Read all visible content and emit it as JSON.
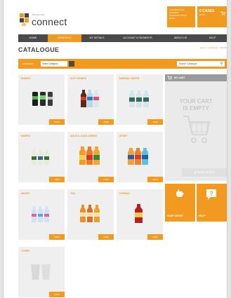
{
  "header": {
    "logo_small": "Woolworths",
    "logo_text": "connect",
    "account_lines": [
      "LOGGED IN AS",
      "MONGRD",
      "ACCOUNT STATE",
      "£8.00"
    ],
    "cart_count": "0 CASES",
    "cart_amount": "£0.00"
  },
  "nav": {
    "items": [
      {
        "label": "HOME",
        "active": false
      },
      {
        "label": "ORDERING",
        "active": true
      },
      {
        "label": "MY DETAILS",
        "active": false
      },
      {
        "label": "ACCOUNT & PAYMENTS",
        "active": false
      },
      {
        "label": "ABOUT US",
        "active": false
      },
      {
        "label": "HELP",
        "active": false
      }
    ]
  },
  "page": {
    "title": "CATALOGUE",
    "breadcrumb": {
      "home": "Home",
      "sep1": " > ",
      "catalogue": "Catalogue",
      "sep2": " > ",
      "current": "Search"
    }
  },
  "filter": {
    "label": "CATEGORY",
    "select_value": "Select Category",
    "search_placeholder": "Search Catalogue"
  },
  "categories": [
    {
      "name": "ENERGY",
      "view": "VIEW"
    },
    {
      "name": "SOFT DRINKS",
      "view": "VIEW"
    },
    {
      "name": "MINERAL WATER",
      "view": "VIEW"
    },
    {
      "name": "MIXERS",
      "view": "VIEW"
    },
    {
      "name": "JUICE & JUICE DRINKS",
      "view": "VIEW"
    },
    {
      "name": "SPORT",
      "view": "VIEW"
    },
    {
      "name": "WATER",
      "view": "VIEW"
    },
    {
      "name": "TEA",
      "view": "VIEW"
    },
    {
      "name": "CORDIAL",
      "view": "VIEW"
    },
    {
      "name": "OTHER",
      "view": "VIEW"
    }
  ],
  "cart": {
    "title": "MY CART",
    "empty_line1": "YOUR CART",
    "empty_line2": "IS EMPTY",
    "checkout": "CHECKOUT"
  },
  "actions": {
    "snap": "SNAP ORDER",
    "help": "HELP"
  },
  "colors": {
    "accent": "#f29a1f",
    "nav_bg": "#4a4a4a",
    "tile_bg": "#efefef"
  }
}
